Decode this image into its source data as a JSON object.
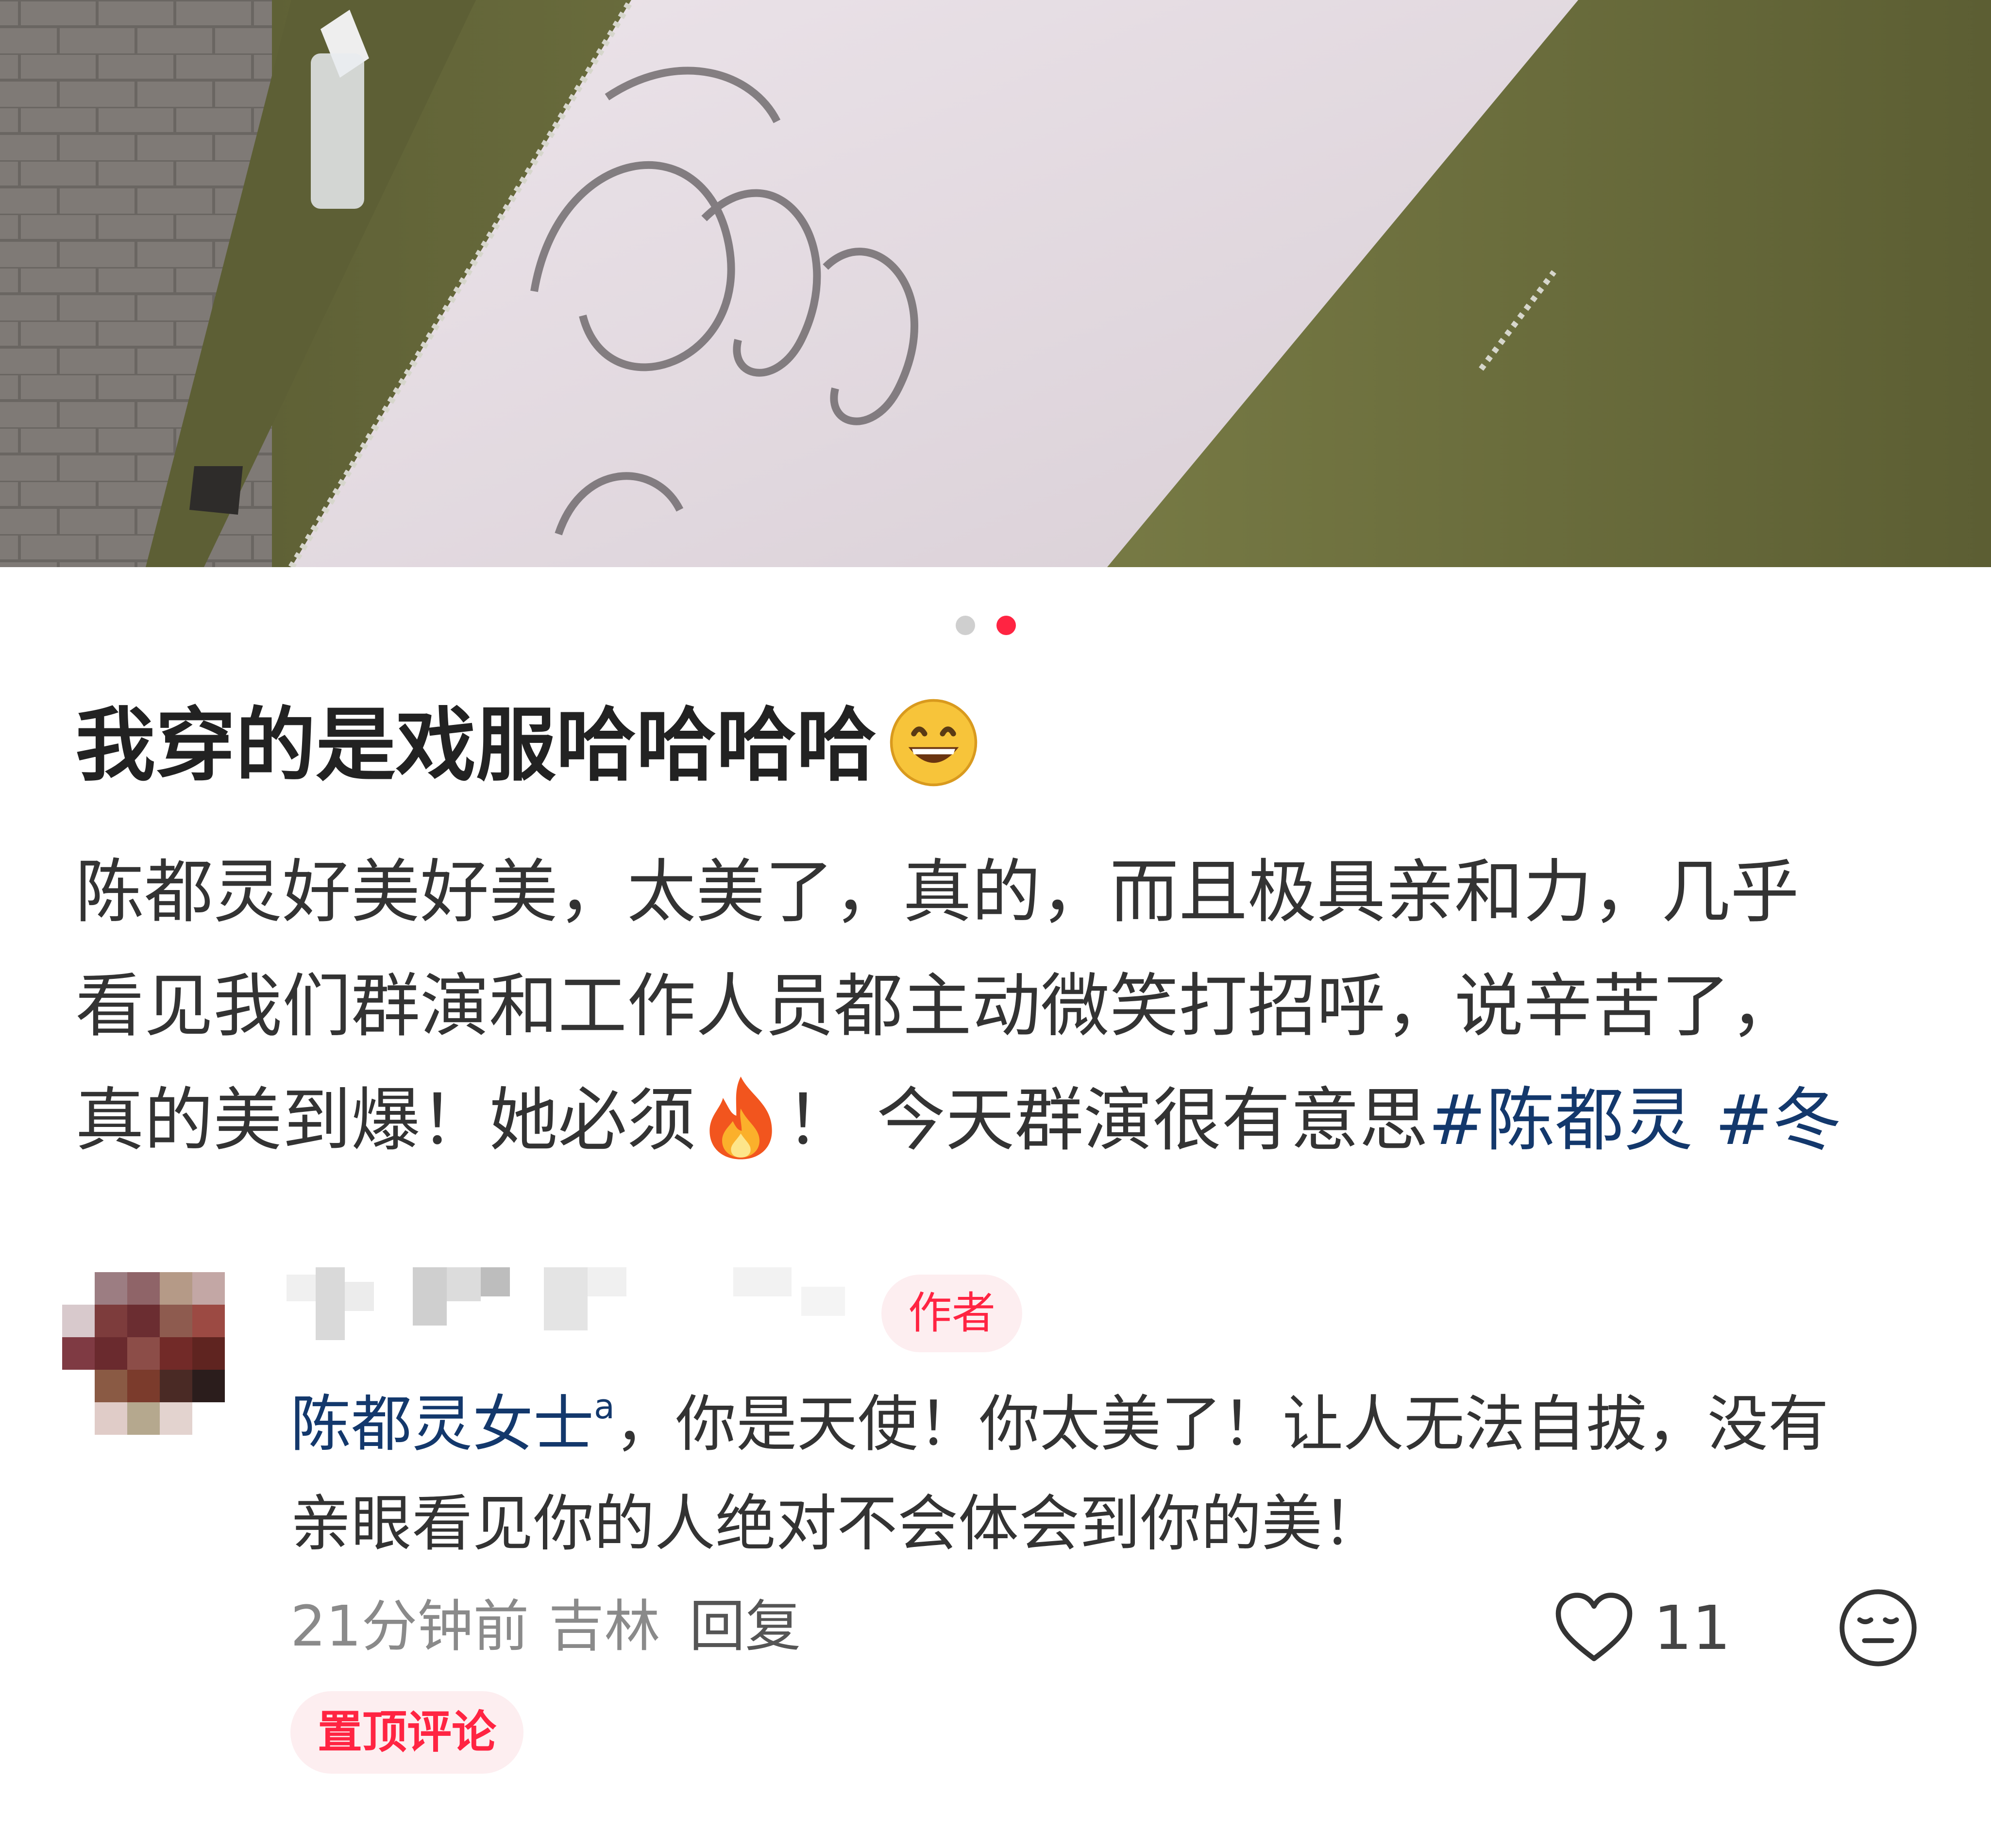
{
  "carousel": {
    "total": 2,
    "active_index": 2,
    "dot_colors": {
      "inactive": "#cfcfcf",
      "active": "#ff2442"
    }
  },
  "post": {
    "title": "我穿的是戏服哈哈哈哈",
    "title_emoji": "grinning-face-icon",
    "body_lines": [
      "陈都灵好美好美，太美了，真的，而且极具亲和力，几乎",
      "看见我们群演和工作人员都主动微笑打招呼，说辛苦了，",
      "真的美到爆！她必须"
    ],
    "body_line3_after_emoji": "！ 今天群演很有意思",
    "body_emoji": "fire-icon",
    "tags": [
      "#陈都灵",
      "#冬"
    ]
  },
  "comment": {
    "author_badge": "作者",
    "mention": "陈都灵女士",
    "text_line1": "，你是天使！你太美了！让人无法自拔，没有",
    "text_line2": "亲眼看见你的人绝对不会体会到你的美！",
    "time": "21分钟前",
    "location": "吉林",
    "reply_label": "回复",
    "like_count": "11",
    "pinned_label": "置顶评论"
  },
  "colors": {
    "accent": "#ff2442",
    "accent_bg": "#fdeef0",
    "link": "#13386c"
  }
}
